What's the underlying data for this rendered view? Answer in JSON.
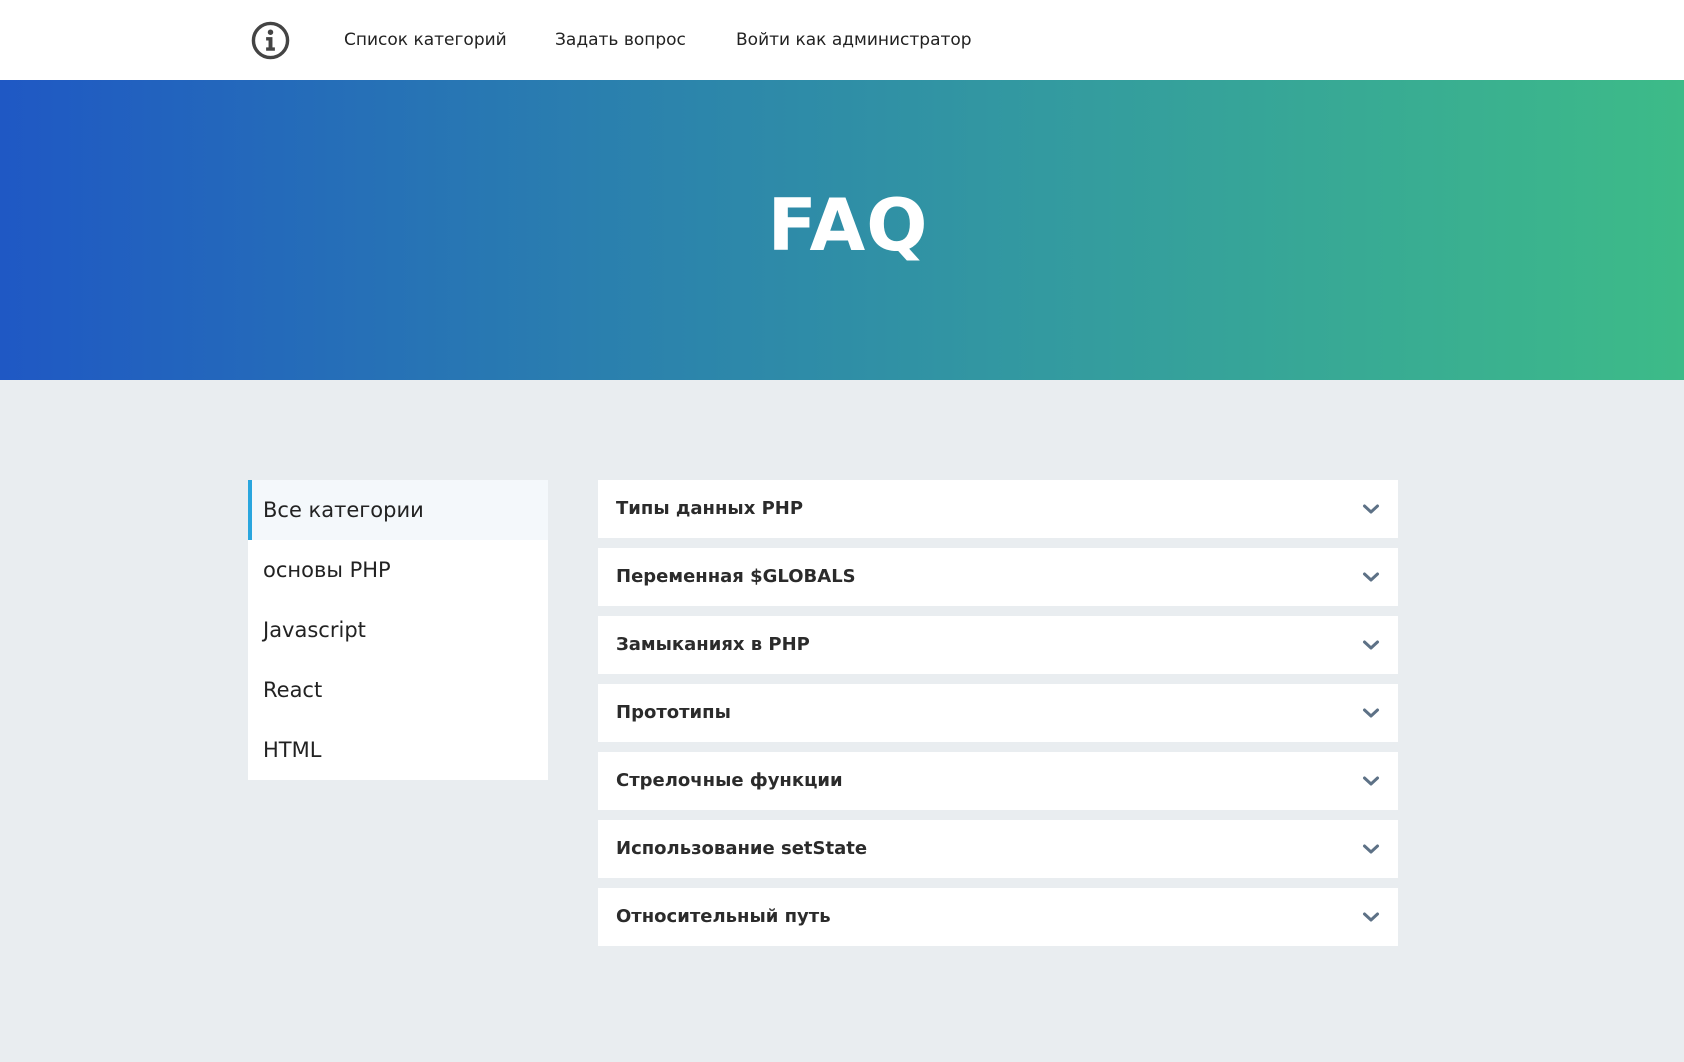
{
  "header": {
    "logo_icon": "info-circle-icon",
    "nav": [
      {
        "label": "Список категорий"
      },
      {
        "label": "Задать вопрос"
      },
      {
        "label": "Войти как администратор"
      }
    ]
  },
  "hero": {
    "title": "FAQ",
    "gradient_start": "#1f58c4",
    "gradient_end": "#3dbb88"
  },
  "sidebar": {
    "active_index": 0,
    "accent": "#2aa6de",
    "items": [
      {
        "label": "Все категории"
      },
      {
        "label": "основы PHP"
      },
      {
        "label": "Javascript"
      },
      {
        "label": "React"
      },
      {
        "label": "HTML"
      }
    ]
  },
  "faq": {
    "expand_icon": "chevron-down-icon",
    "items": [
      {
        "question": "Типы данных PHP"
      },
      {
        "question": "Переменная $GLOBALS"
      },
      {
        "question": "Замыканиях в PHP"
      },
      {
        "question": "Прототипы"
      },
      {
        "question": "Стрелочные функции"
      },
      {
        "question": "Использование setState"
      },
      {
        "question": "Относительный путь"
      }
    ]
  }
}
